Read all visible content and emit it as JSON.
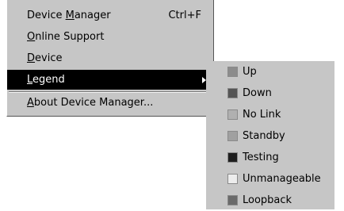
{
  "menu": {
    "items": [
      {
        "pre": "Device ",
        "mn": "M",
        "post": "anager",
        "accel": "Ctrl+F"
      },
      {
        "pre": "",
        "mn": "O",
        "post": "nline Support",
        "accel": ""
      },
      {
        "pre": "",
        "mn": "D",
        "post": "evice",
        "accel": ""
      },
      {
        "pre": "",
        "mn": "L",
        "post": "egend",
        "accel": ""
      },
      {
        "pre": "",
        "mn": "A",
        "post": "bout Device Manager...",
        "accel": ""
      }
    ]
  },
  "legend": {
    "items": [
      {
        "label": "Up",
        "color": "#8c8c8c"
      },
      {
        "label": "Down",
        "color": "#555555"
      },
      {
        "label": "No Link",
        "color": "#b0b0b0"
      },
      {
        "label": "Standby",
        "color": "#a0a0a0"
      },
      {
        "label": "Testing",
        "color": "#1e1e1e"
      },
      {
        "label": "Unmanageable",
        "color": "#ececec"
      },
      {
        "label": "Loopback",
        "color": "#6a6a6a"
      }
    ]
  }
}
